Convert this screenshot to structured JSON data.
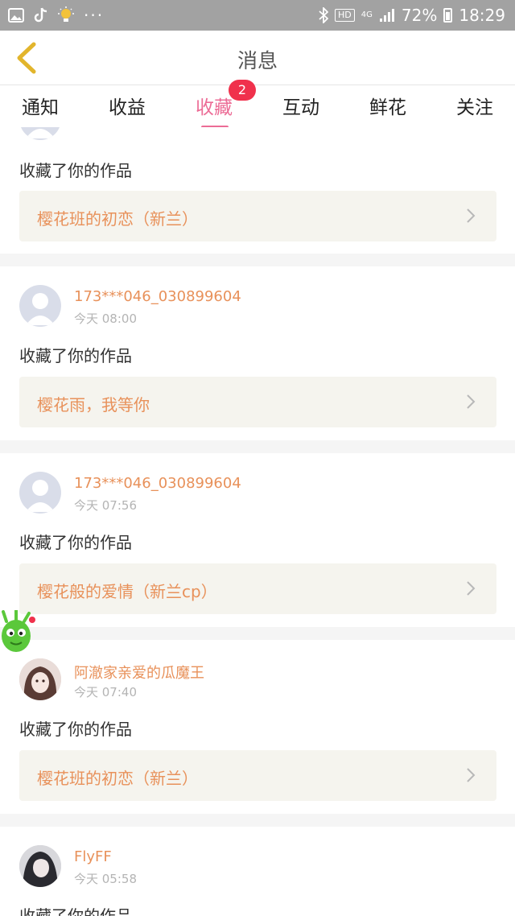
{
  "status_bar": {
    "battery": "72%",
    "time": "18:29",
    "hd": "HD",
    "network": "4G"
  },
  "header": {
    "title": "消息"
  },
  "tabs": [
    {
      "label": "通知"
    },
    {
      "label": "收益"
    },
    {
      "label": "收藏",
      "badge": "2"
    },
    {
      "label": "互动"
    },
    {
      "label": "鲜花"
    },
    {
      "label": "关注"
    }
  ],
  "items": [
    {
      "action": "收藏了你的作品",
      "work": "樱花班的初恋（新兰）"
    },
    {
      "username": "173***046_030899604",
      "time": "今天 08:00",
      "action": "收藏了你的作品",
      "work": "樱花雨，我等你"
    },
    {
      "username": "173***046_030899604",
      "time": "今天 07:56",
      "action": "收藏了你的作品",
      "work": "樱花般的爱情（新兰cp）"
    },
    {
      "username": "阿澈家亲爱的瓜魔王",
      "time": "今天 07:40",
      "action": "收藏了你的作品",
      "work": "樱花班的初恋（新兰）"
    },
    {
      "username": "FlyFF",
      "time": "今天 05:58",
      "action": "收藏了你的作品"
    }
  ],
  "colors": {
    "accent": "#ec6c96",
    "badge": "#f0314c",
    "username": "#e8915a"
  }
}
